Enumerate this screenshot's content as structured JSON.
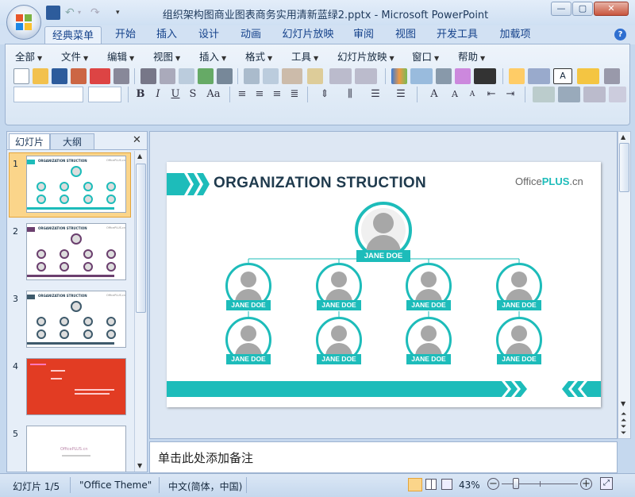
{
  "window": {
    "title": "组织架构图商业图表商务实用清新蓝绿2.pptx - Microsoft PowerPoint",
    "minimize": "—",
    "maximize": "▢",
    "close": "✕"
  },
  "tabs": [
    "经典菜单",
    "开始",
    "插入",
    "设计",
    "动画",
    "幻灯片放映",
    "审阅",
    "视图",
    "开发工具",
    "加载项"
  ],
  "classic_menu": [
    "全部",
    "文件",
    "编辑",
    "视图",
    "插入",
    "格式",
    "工具",
    "幻灯片放映",
    "窗口",
    "帮助"
  ],
  "left_pane": {
    "tab_slides": "幻灯片",
    "tab_outline": "大纲",
    "close": "✕",
    "thumbs": [
      {
        "num": "1",
        "title": "ORGANIZATION STRUCTION",
        "brand": "OfficePLUS.cn"
      },
      {
        "num": "2",
        "title": "ORGANIZATION STRUCTION",
        "brand": "OfficePLUS.cn"
      },
      {
        "num": "3",
        "title": "ORGANIZATION STRUCTION",
        "brand": "OfficePLUS.cn"
      },
      {
        "num": "4"
      },
      {
        "num": "5",
        "brand": "OfficePLUS.cn"
      }
    ]
  },
  "slide": {
    "title": "ORGANIZATION STRUCTION",
    "brand_prefix": "Office",
    "brand_plus": "PLUS",
    "brand_suffix": ".cn",
    "top_name": "JANE DOE",
    "row1": [
      "JANE DOE",
      "JANE DOE",
      "JANE DOE",
      "JANE DOE"
    ],
    "row2": [
      "JANE DOE",
      "JANE DOE",
      "JANE DOE",
      "JANE DOE"
    ],
    "accent_color": "#1dbcba",
    "title_color": "#1f3a4d"
  },
  "notes_placeholder": "单击此处添加备注",
  "status": {
    "slide_info": "幻灯片 1/5",
    "theme": "\"Office Theme\"",
    "language": "中文(简体，中国)",
    "zoom": "43%"
  }
}
